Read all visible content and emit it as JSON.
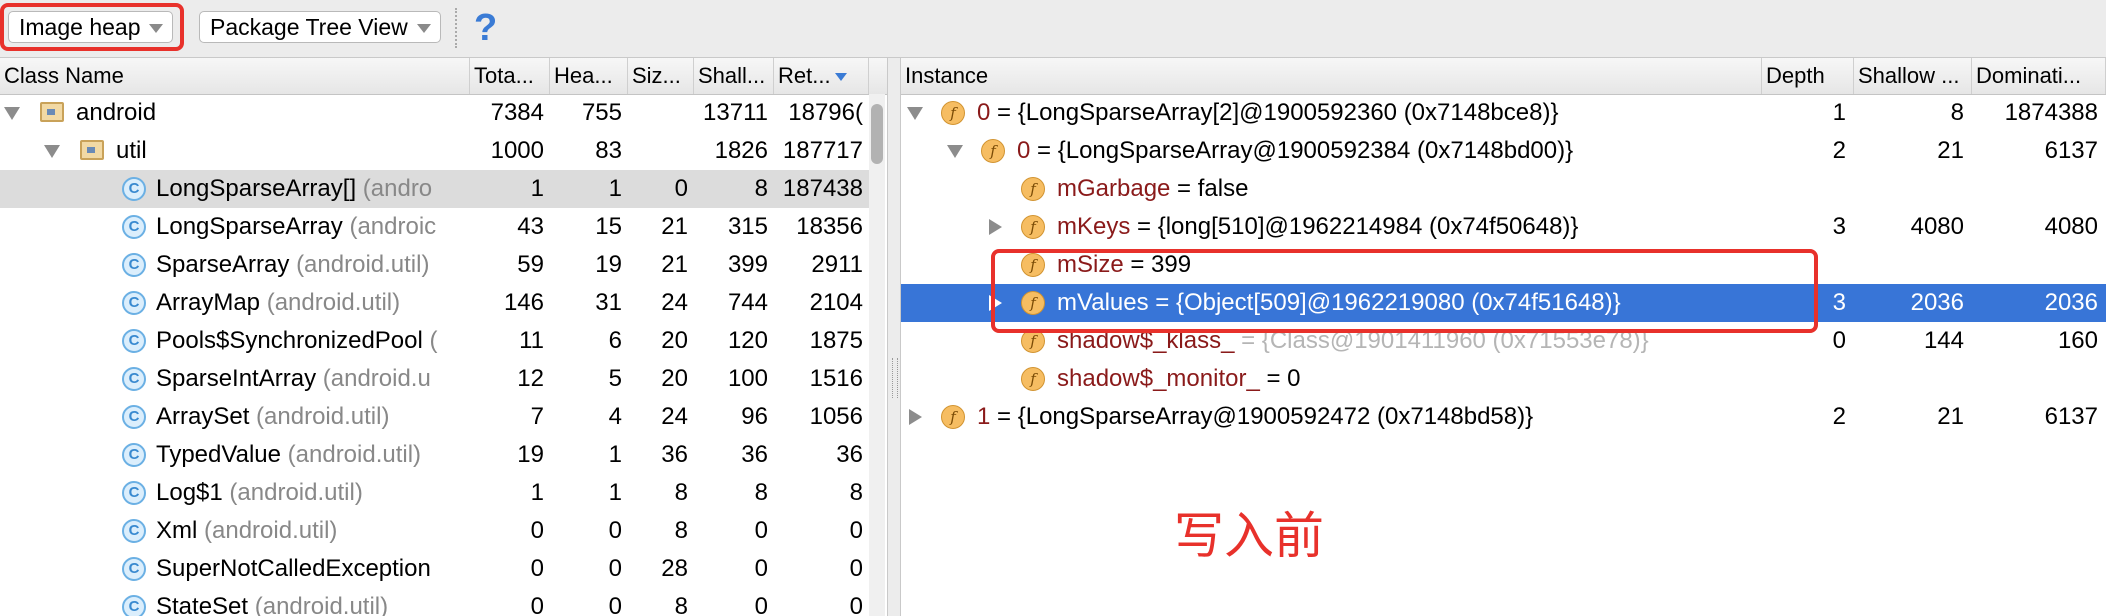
{
  "toolbar": {
    "heap_select": "Image heap",
    "view_select": "Package Tree View",
    "help_label": "?"
  },
  "class_table": {
    "columns": [
      "Class Name",
      "Tota...",
      "Hea...",
      "Siz...",
      "Shall...",
      "Ret..."
    ],
    "rows": [
      {
        "kind": "package",
        "expand": "down",
        "name": "android",
        "pkg": "",
        "total": "7384",
        "heap": "755",
        "size": "",
        "shallow": "13711",
        "retained": "18796("
      },
      {
        "kind": "package",
        "expand": "down",
        "name": "util",
        "pkg": "",
        "total": "1000",
        "heap": "83",
        "size": "",
        "shallow": "1826",
        "retained": "187717"
      },
      {
        "kind": "class",
        "expand": "",
        "name": "LongSparseArray[]",
        "pkg": "(andro",
        "total": "1",
        "heap": "1",
        "size": "0",
        "shallow": "8",
        "retained": "187438"
      },
      {
        "kind": "class",
        "expand": "",
        "name": "LongSparseArray",
        "pkg": "(androic",
        "total": "43",
        "heap": "15",
        "size": "21",
        "shallow": "315",
        "retained": "18356"
      },
      {
        "kind": "class",
        "expand": "",
        "name": "SparseArray",
        "pkg": "(android.util)",
        "total": "59",
        "heap": "19",
        "size": "21",
        "shallow": "399",
        "retained": "2911"
      },
      {
        "kind": "class",
        "expand": "",
        "name": "ArrayMap",
        "pkg": "(android.util)",
        "total": "146",
        "heap": "31",
        "size": "24",
        "shallow": "744",
        "retained": "2104"
      },
      {
        "kind": "class",
        "expand": "",
        "name": "Pools$SynchronizedPool",
        "pkg": "(",
        "total": "11",
        "heap": "6",
        "size": "20",
        "shallow": "120",
        "retained": "1875"
      },
      {
        "kind": "class",
        "expand": "",
        "name": "SparseIntArray",
        "pkg": "(android.u",
        "total": "12",
        "heap": "5",
        "size": "20",
        "shallow": "100",
        "retained": "1516"
      },
      {
        "kind": "class",
        "expand": "",
        "name": "ArraySet",
        "pkg": "(android.util)",
        "total": "7",
        "heap": "4",
        "size": "24",
        "shallow": "96",
        "retained": "1056"
      },
      {
        "kind": "class",
        "expand": "",
        "name": "TypedValue",
        "pkg": "(android.util)",
        "total": "19",
        "heap": "1",
        "size": "36",
        "shallow": "36",
        "retained": "36"
      },
      {
        "kind": "class",
        "expand": "",
        "name": "Log$1",
        "pkg": "(android.util)",
        "total": "1",
        "heap": "1",
        "size": "8",
        "shallow": "8",
        "retained": "8"
      },
      {
        "kind": "class",
        "expand": "",
        "name": "Xml",
        "pkg": "(android.util)",
        "total": "0",
        "heap": "0",
        "size": "8",
        "shallow": "0",
        "retained": "0"
      },
      {
        "kind": "class",
        "expand": "",
        "name": "SuperNotCalledException",
        "pkg": "",
        "total": "0",
        "heap": "0",
        "size": "28",
        "shallow": "0",
        "retained": "0"
      },
      {
        "kind": "class",
        "expand": "",
        "name": "StateSet",
        "pkg": "(android.util)",
        "total": "0",
        "heap": "0",
        "size": "8",
        "shallow": "0",
        "retained": "0"
      }
    ]
  },
  "instance_table": {
    "columns": [
      "Instance",
      "Depth",
      "Shallow ...",
      "Dominati..."
    ],
    "rows": [
      {
        "expand": "down",
        "name": "0",
        "value": " = {LongSparseArray[2]@1900592360 (0x7148bce8)}",
        "depth": "1",
        "shallow": "8",
        "dominating": "1874388"
      },
      {
        "expand": "down",
        "name": "0",
        "value": " = {LongSparseArray@1900592384 (0x7148bd00)}",
        "depth": "2",
        "shallow": "21",
        "dominating": "6137"
      },
      {
        "expand": "",
        "name": "mGarbage",
        "value": " = false",
        "depth": "",
        "shallow": "",
        "dominating": ""
      },
      {
        "expand": "right",
        "name": "mKeys",
        "value": " = {long[510]@1962214984 (0x74f50648)}",
        "depth": "3",
        "shallow": "4080",
        "dominating": "4080"
      },
      {
        "expand": "",
        "name": "mSize",
        "value": " = 399",
        "depth": "",
        "shallow": "",
        "dominating": ""
      },
      {
        "expand": "right",
        "name": "mValues",
        "value": " = {Object[509]@1962219080 (0x74f51648)}",
        "depth": "3",
        "shallow": "2036",
        "dominating": "2036"
      },
      {
        "expand": "",
        "name": "shadow$_klass_",
        "value": " = {Class@1901411960 (0x71553e78)}",
        "depth": "0",
        "shallow": "144",
        "dominating": "160"
      },
      {
        "expand": "",
        "name": "shadow$_monitor_",
        "value": " = 0",
        "depth": "",
        "shallow": "",
        "dominating": ""
      },
      {
        "expand": "right",
        "name": "1",
        "value": " = {LongSparseArray@1900592472 (0x7148bd58)}",
        "depth": "2",
        "shallow": "21",
        "dominating": "6137"
      }
    ]
  },
  "annotation": {
    "text": "写入前",
    "color": "#e8312b"
  },
  "colors": {
    "selection_blue": "#3875d7",
    "selection_grey": "#dcdcdc",
    "field_name": "#8a1a1a",
    "package_text": "#888888",
    "highlight_red": "#e8312b"
  }
}
